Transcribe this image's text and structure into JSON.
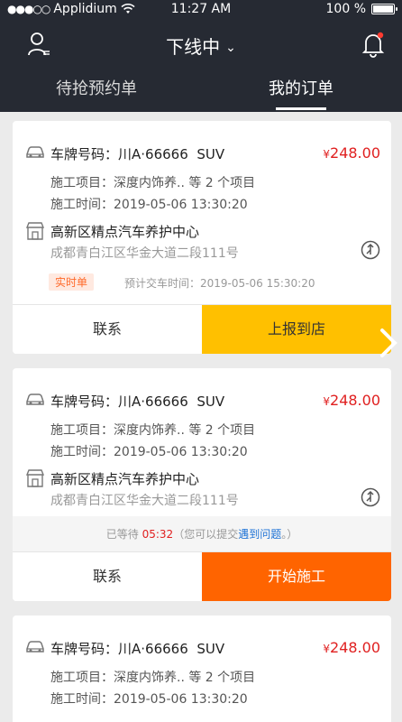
{
  "status": {
    "carrier": "Applidium",
    "time": "11:27 AM",
    "battery": "100 %"
  },
  "nav": {
    "title": "下线中",
    "user_icon": "user-icon",
    "bell_icon": "bell-icon"
  },
  "tabs": [
    {
      "label": "待抢预约单",
      "active": false
    },
    {
      "label": "我的订单",
      "active": true
    }
  ],
  "orders": [
    {
      "plate_label": "车牌号码：",
      "plate": "川A·66666",
      "car_type": "SUV",
      "currency": "¥",
      "price": "248.00",
      "service_label": "施工项目：",
      "service": "深度内饰养..   等 2 个项目",
      "time_label": "施工时间：",
      "time": "2019-05-06  13:30:20",
      "shop": "高新区精点汽车养护中心",
      "address": "成都青白江区华金大道二段111号",
      "badge": "实时单",
      "eta_label": "预计交车时间：",
      "eta": "2019-05-06  15:30:20",
      "contact": "联系",
      "action": "上报到店"
    },
    {
      "plate_label": "车牌号码：",
      "plate": "川A·66666",
      "car_type": "SUV",
      "currency": "¥",
      "price": "248.00",
      "service_label": "施工项目：",
      "service": "深度内饰养..   等 2 个项目",
      "time_label": "施工时间：",
      "time": "2019-05-06  13:30:20",
      "shop": "高新区精点汽车养护中心",
      "address": "成都青白江区华金大道二段111号",
      "wait_prefix": "已等待 ",
      "wait_time": "05:32",
      "wait_mid": "（您可以提交",
      "wait_link": "遇到问题",
      "wait_suffix": "。）",
      "contact": "联系",
      "action": "开始施工"
    },
    {
      "plate_label": "车牌号码：",
      "plate": "川A·66666",
      "car_type": "SUV",
      "currency": "¥",
      "price": "248.00",
      "service_label": "施工项目：",
      "service": "深度内饰养..   等 2 个项目",
      "time_label": "施工时间：",
      "time": "2019-05-06  13:30:20"
    }
  ],
  "colors": {
    "header": "#262a33",
    "price": "#e02020",
    "yellow": "#ffc000",
    "orange": "#ff6400",
    "link": "#1e73d6"
  }
}
